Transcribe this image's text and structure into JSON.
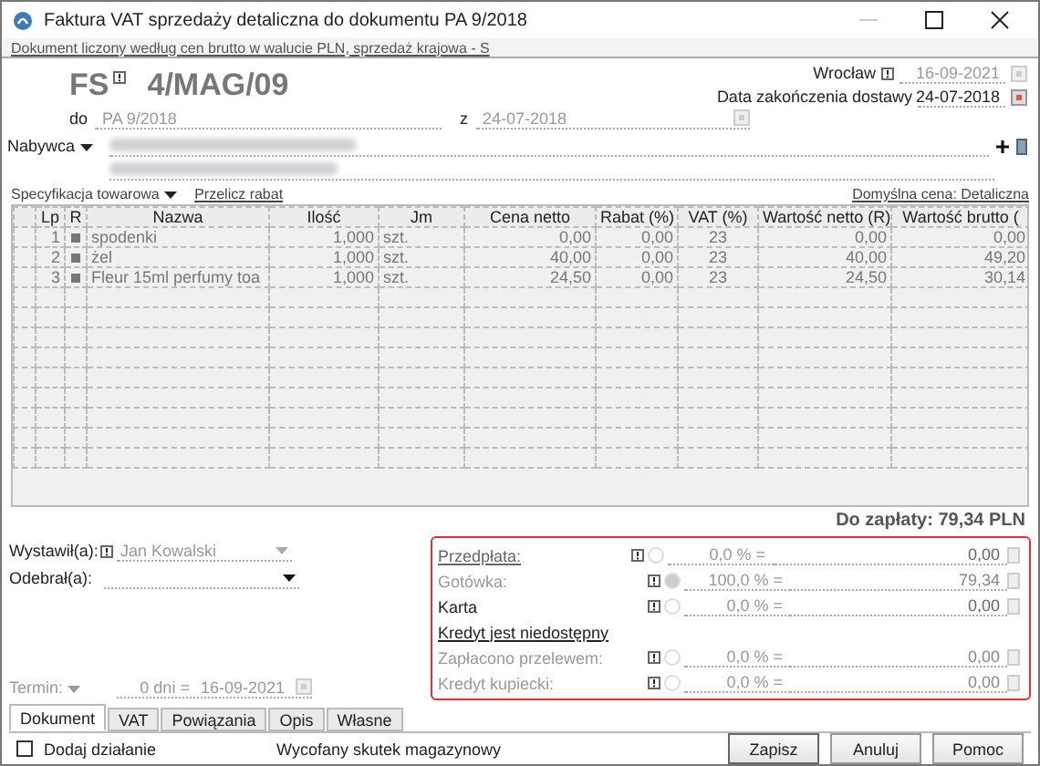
{
  "window": {
    "title": "Faktura VAT sprzedaży detaliczna do dokumentu PA 9/2018"
  },
  "info_link": "Dokument liczony według cen brutto w walucie PLN, sprzedaż krajowa - S",
  "header": {
    "prefix": "FS",
    "number": "4/MAG/09",
    "place": "Wrocław",
    "issue_date": "16-09-2021",
    "delivery_label": "Data zakończenia dostawy",
    "delivery_date": "24-07-2018",
    "to_label": "do",
    "to_value": "PA 9/2018",
    "from_label": "z",
    "from_date": "24-07-2018",
    "buyer_label": "Nabywca"
  },
  "spec": {
    "label": "Specyfikacja towarowa",
    "recalc": "Przelicz rabat",
    "default_price": "Domyślna cena: Detaliczna"
  },
  "table": {
    "columns": [
      "Lp",
      "R",
      "Nazwa",
      "Ilość",
      "Jm",
      "Cena netto",
      "Rabat (%)",
      "VAT (%)",
      "Wartość netto (R)",
      "Wartość brutto ("
    ],
    "rows": [
      {
        "lp": "1",
        "name": "spodenki",
        "qty": "1,000",
        "unit": "szt.",
        "net_price": "0,00",
        "discount": "0,00",
        "vat": "23",
        "net_value": "0,00",
        "gross_value": "0,00"
      },
      {
        "lp": "2",
        "name": "żel",
        "qty": "1,000",
        "unit": "szt.",
        "net_price": "40,00",
        "discount": "0,00",
        "vat": "23",
        "net_value": "40,00",
        "gross_value": "49,20"
      },
      {
        "lp": "3",
        "name": "Fleur 15ml perfumy toa",
        "qty": "1,000",
        "unit": "szt.",
        "net_price": "24,50",
        "discount": "0,00",
        "vat": "23",
        "net_value": "24,50",
        "gross_value": "30,14"
      }
    ]
  },
  "total": "Do zapłaty: 79,34 PLN",
  "issuer": {
    "label": "Wystawił(a):",
    "value": "Jan Kowalski"
  },
  "receiver": {
    "label": "Odebrał(a):"
  },
  "term": {
    "label": "Termin:",
    "days": "0 dni =",
    "date": "16-09-2021"
  },
  "payments": [
    {
      "kind": "row",
      "label": "Przedpłata:",
      "link": true,
      "disabled": false,
      "selected": false,
      "percent": "0,0 % =",
      "amount": "0,00"
    },
    {
      "kind": "row",
      "label": "Gotówka:",
      "link": false,
      "disabled": true,
      "selected": true,
      "percent": "100,0 % =",
      "amount": "79,34"
    },
    {
      "kind": "row",
      "label": "Karta",
      "link": false,
      "disabled": false,
      "selected": false,
      "percent": "0,0 % =",
      "amount": "0,00"
    },
    {
      "kind": "notice",
      "label": "Kredyt jest niedostępny"
    },
    {
      "kind": "row",
      "label": "Zapłacono przelewem:",
      "link": false,
      "disabled": true,
      "selected": false,
      "percent": "0,0 % =",
      "amount": "0,00"
    },
    {
      "kind": "row",
      "label": "Kredyt kupiecki:",
      "link": false,
      "disabled": true,
      "selected": false,
      "percent": "0,0 % =",
      "amount": "0,00"
    }
  ],
  "tabs": [
    {
      "label": "Dokument",
      "selected": true
    },
    {
      "label": "VAT",
      "selected": false
    },
    {
      "label": "Powiązania",
      "selected": false
    },
    {
      "label": "Opis",
      "selected": false
    },
    {
      "label": "Własne",
      "selected": false
    }
  ],
  "action_checkbox": {
    "label": "Dodaj działanie",
    "checked": false
  },
  "status": "Wycofany skutek magazynowy",
  "buttons": [
    "Zapisz",
    "Anuluj",
    "Pomoc"
  ]
}
